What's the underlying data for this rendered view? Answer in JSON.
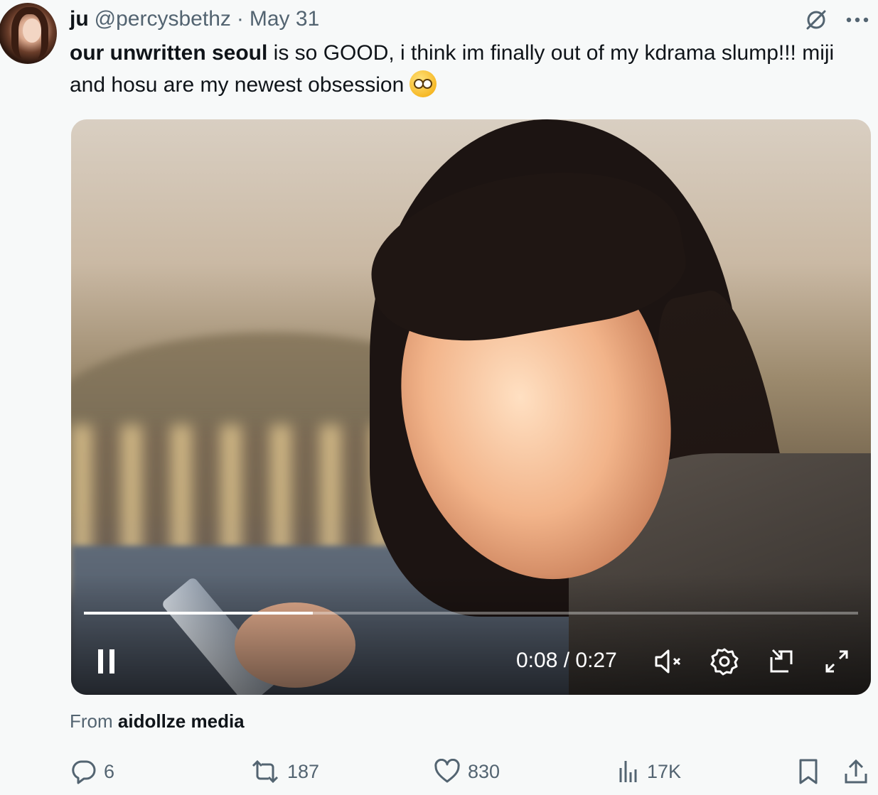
{
  "author": {
    "display_name": "ju",
    "handle": "@percysbethz",
    "separator": "·",
    "date": "May 31"
  },
  "header_icons": [
    "grok-icon",
    "more-icon"
  ],
  "tweet": {
    "title_bold": "our unwritten seoul",
    "text": " is so GOOD, i think im finally out of my kdrama slump!!! miji and hosu are my newest obsession",
    "emoji": "pleading-face-emoji"
  },
  "video": {
    "current_time": "0:08",
    "time_separator": " / ",
    "duration": "0:27",
    "progress_fraction": 0.296,
    "controls": [
      "pause-icon",
      "muted-icon",
      "settings-icon",
      "pip-icon",
      "fullscreen-icon"
    ]
  },
  "attribution": {
    "prefix": "From",
    "source": "aidollze media"
  },
  "actions": {
    "replies": "6",
    "reposts": "187",
    "likes": "830",
    "views": "17K"
  }
}
